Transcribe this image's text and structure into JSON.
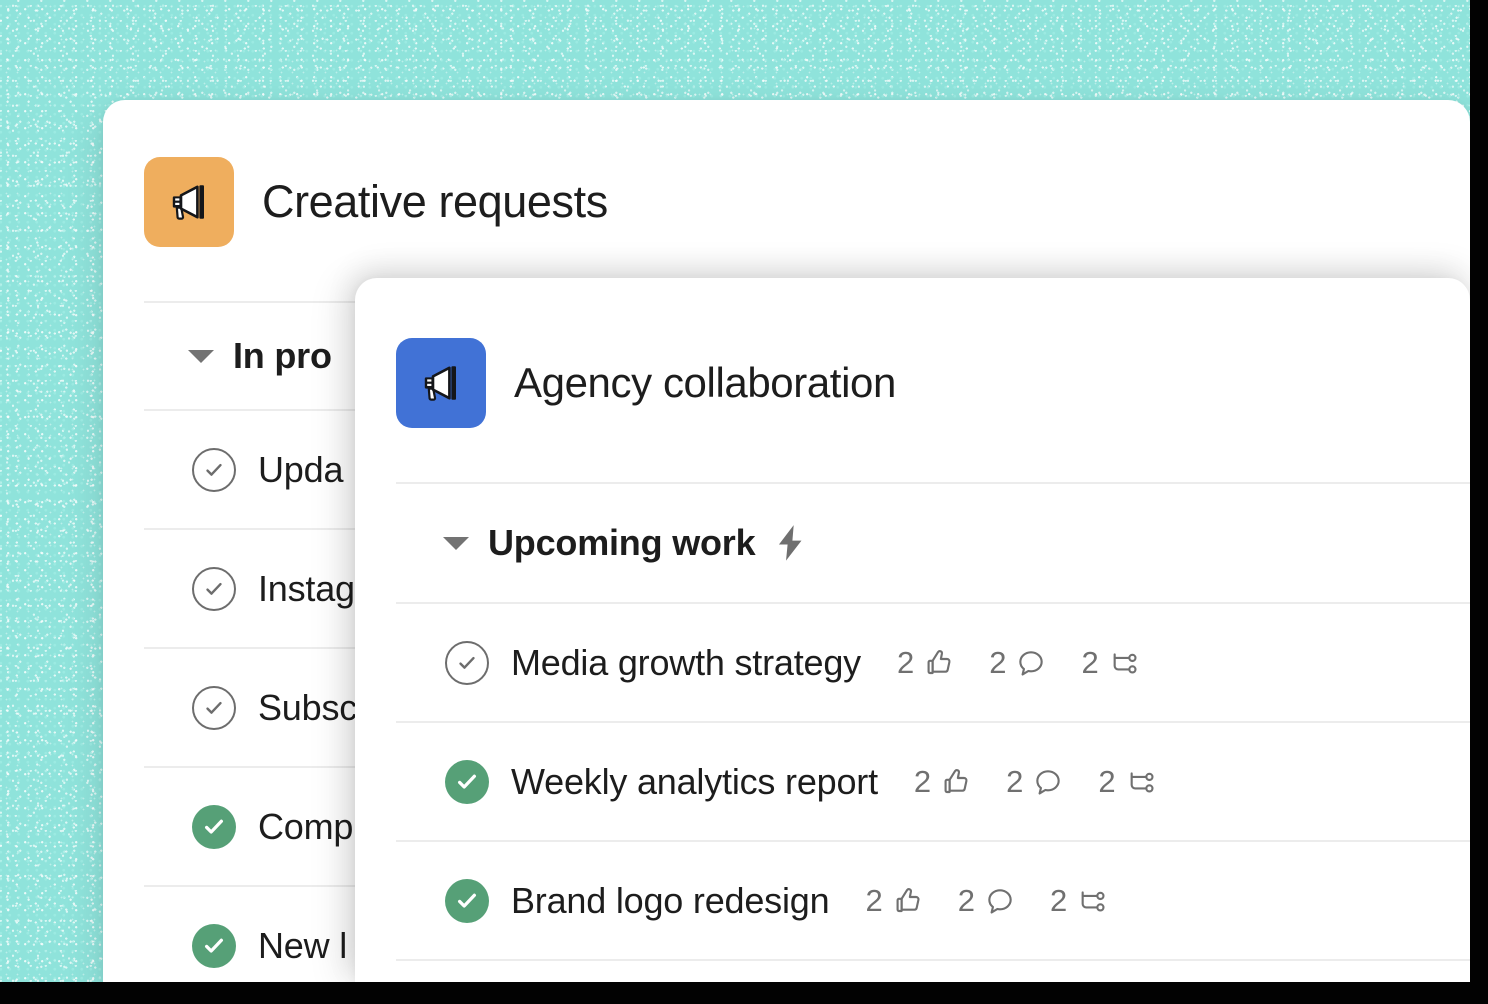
{
  "theme": {
    "background_color": "#8FE3DB",
    "card_color": "#FFFFFF",
    "accent_orange": "#EFAE5E",
    "accent_blue": "#4172D6",
    "done_green": "#56A077",
    "divider_gray": "#ECECEC",
    "meta_gray": "#707070",
    "text_color": "#1D1D1D"
  },
  "back_card": {
    "icon_name": "megaphone-icon",
    "icon_color": "#EFAE5E",
    "title": "Creative requests",
    "section": {
      "label": "In pro",
      "caret": "chevron-down-icon",
      "expanded": true
    },
    "tasks": [
      {
        "label": "Upda",
        "state": "open"
      },
      {
        "label": "Instag",
        "state": "open"
      },
      {
        "label": "Subsc",
        "state": "open"
      },
      {
        "label": "Comp",
        "state": "done"
      },
      {
        "label": "New l",
        "state": "done"
      }
    ]
  },
  "front_card": {
    "icon_name": "megaphone-icon",
    "icon_color": "#4172D6",
    "title": "Agency collaboration",
    "section": {
      "label": "Upcoming work",
      "caret": "chevron-down-icon",
      "badge_icon": "lightning-bolt-icon",
      "expanded": true
    },
    "tasks": [
      {
        "label": "Media growth strategy",
        "state": "open",
        "likes": "2",
        "comments": "2",
        "subtasks": "2"
      },
      {
        "label": "Weekly analytics report",
        "state": "done",
        "likes": "2",
        "comments": "2",
        "subtasks": "2"
      },
      {
        "label": "Brand logo redesign",
        "state": "done",
        "likes": "2",
        "comments": "2",
        "subtasks": "2"
      }
    ],
    "meta_icons": {
      "likes": "thumbs-up-icon",
      "comments": "comment-bubble-icon",
      "subtasks": "subtask-branch-icon"
    }
  }
}
